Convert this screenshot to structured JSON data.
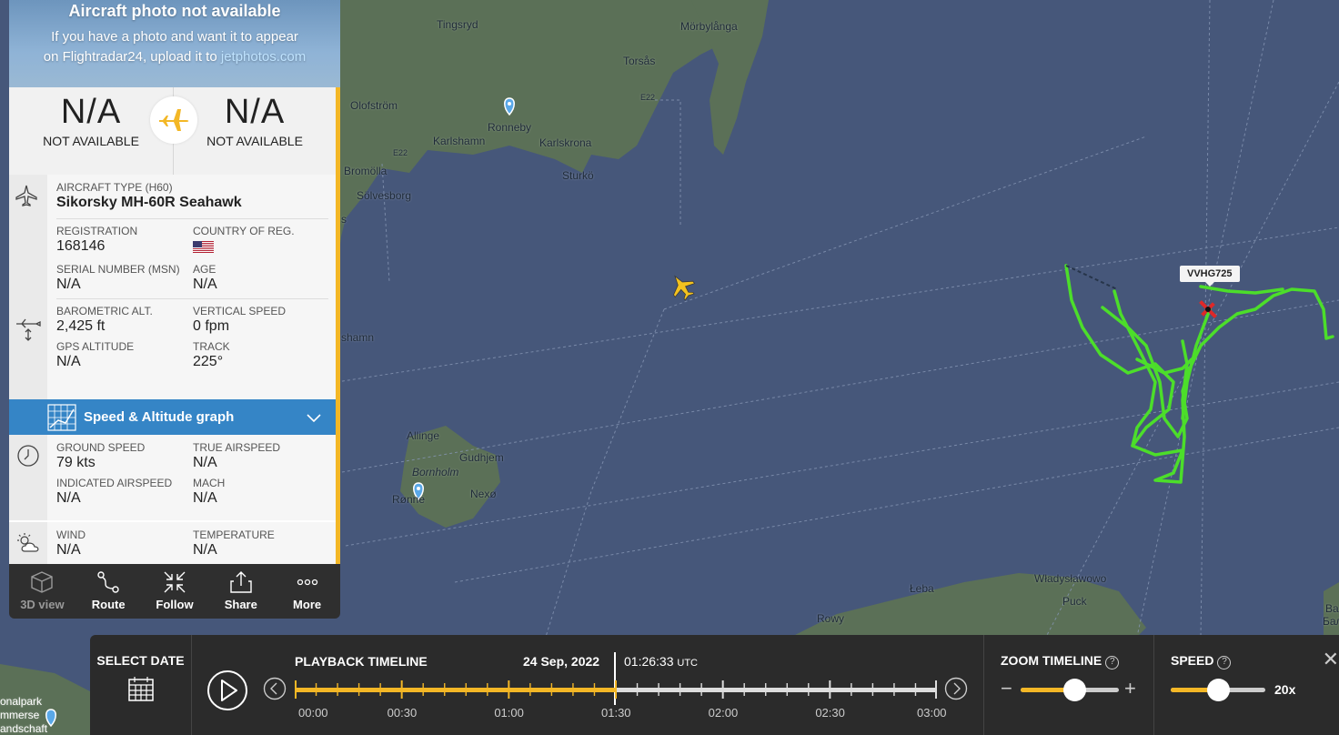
{
  "photo": {
    "title": "Aircraft photo not available",
    "line1": "If you have a photo and want it to appear",
    "line2_prefix": "on Flightradar24, upload it to ",
    "line2_link": "jetphotos.com"
  },
  "route": {
    "origin_code": "N/A",
    "origin_name": "NOT AVAILABLE",
    "destination_code": "N/A",
    "destination_name": "NOT AVAILABLE"
  },
  "aircraft": {
    "type_label": "AIRCRAFT TYPE",
    "type_code": "(H60)",
    "type_name": "Sikorsky MH-60R Seahawk",
    "registration_label": "REGISTRATION",
    "registration": "168146",
    "country_label": "COUNTRY OF REG.",
    "serial_label": "SERIAL NUMBER (MSN)",
    "serial": "N/A",
    "age_label": "AGE",
    "age": "N/A"
  },
  "altitude": {
    "baro_label": "BAROMETRIC ALT.",
    "baro": "2,425 ft",
    "vs_label": "VERTICAL SPEED",
    "vs": "0 fpm",
    "gps_label": "GPS ALTITUDE",
    "gps": "N/A",
    "track_label": "TRACK",
    "track": "225°"
  },
  "graph_bar": {
    "label": "Speed & Altitude graph"
  },
  "speed": {
    "gs_label": "GROUND SPEED",
    "gs": "79 kts",
    "tas_label": "TRUE AIRSPEED",
    "tas": "N/A",
    "ias_label": "INDICATED AIRSPEED",
    "ias": "N/A",
    "mach_label": "MACH",
    "mach": "N/A"
  },
  "weather": {
    "wind_label": "WIND",
    "wind": "N/A",
    "temp_label": "TEMPERATURE",
    "temp": "N/A"
  },
  "toolbar": {
    "view3d": "3D view",
    "route": "Route",
    "follow": "Follow",
    "share": "Share",
    "more": "More"
  },
  "map": {
    "callsign": "VVHG725",
    "labels": {
      "tingsryd": "Tingsryd",
      "morbylanga": "Mörbylånga",
      "torsas": "Torsås",
      "olofstrom": "Olofström",
      "ronneby": "Ronneby",
      "karlshamn": "Karlshamn",
      "karlskrona": "Karlskrona",
      "bromolla": "Bromölla",
      "solvesborg": "Sölvesborg",
      "sturko": "Sturkö",
      "e22a": "E22",
      "e22b": "E22",
      "shamn": "shamn",
      "allinge": "Allinge",
      "gudhjem": "Gudhjem",
      "bornholm": "Bornholm",
      "nexo": "Nexø",
      "ronne": "Rønne",
      "wladyslawowo": "Władysławowo",
      "puck": "Puck",
      "leba": "Łeba",
      "rowy": "Rowy",
      "nationalpark": "onalpark",
      "vorpommerse": "mmerse",
      "landschaft": "andschaft",
      "edge_s": "s",
      "edge_ba": "Ba",
      "edge_bal": "Бал"
    }
  },
  "timeline": {
    "select_date": "SELECT DATE",
    "playback_title": "PLAYBACK TIMELINE",
    "date": "24 Sep, 2022",
    "time": "01:26:33",
    "tz": "UTC",
    "tick_labels": [
      "00:00",
      "00:30",
      "01:00",
      "01:30",
      "02:00",
      "02:30",
      "03:00"
    ],
    "progress": 0.5,
    "zoom_title": "ZOOM TIMELINE",
    "zoom_level": 0.55,
    "speed_title": "SPEED",
    "speed_value": "20x",
    "speed_level": 0.5
  },
  "colors": {
    "accent": "#f3b726",
    "track": "#4cde2a",
    "panel_blue": "#3585c6"
  }
}
